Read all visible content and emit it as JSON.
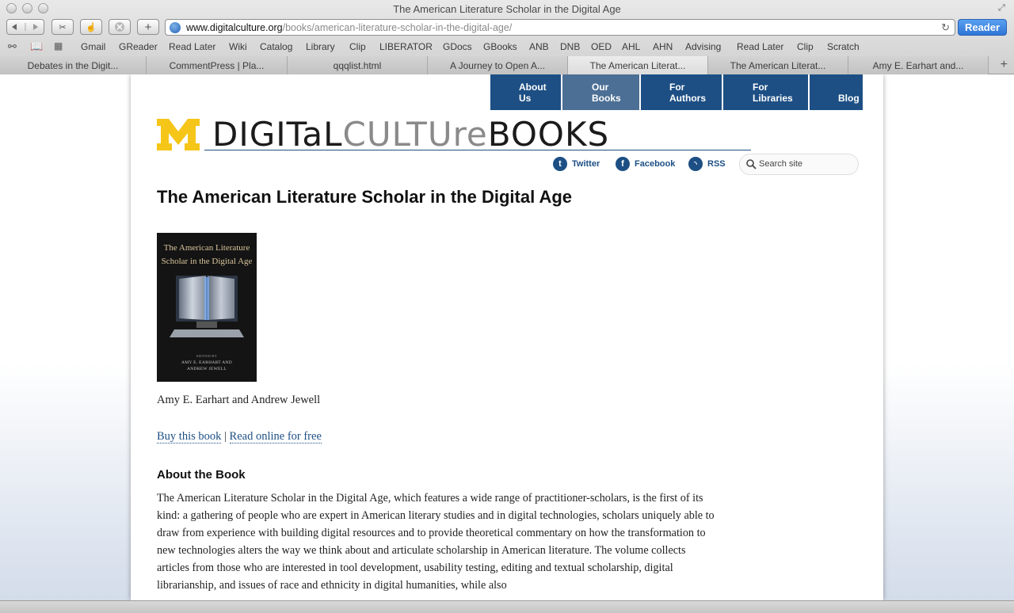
{
  "window": {
    "title": "The American Literature Scholar in the Digital Age"
  },
  "toolbar": {
    "url_host": "www.digitalculture.org",
    "url_path": "/books/american-literature-scholar-in-the-digital-age/",
    "reader_label": "Reader"
  },
  "bookmarks": [
    "Gmail",
    "GReader",
    "Read Later",
    "Wiki",
    "Catalog",
    "Library",
    "Clip",
    "LIBERATOR",
    "GDocs",
    "GBooks",
    "ANB",
    "DNB",
    "OED",
    "AHL",
    "AHN",
    "Advising",
    "Read Later",
    "Clip",
    "Scratch"
  ],
  "tabs": [
    "Debates in the Digit...",
    "CommentPress | Pla...",
    "qqqlist.html",
    "A Journey to Open A...",
    "The American Literat...",
    "The American Literat...",
    "Amy E. Earhart and..."
  ],
  "site": {
    "nav": [
      "About Us",
      "Our Books",
      "For Authors",
      "For Libraries",
      "Blog"
    ],
    "logo_m": "M",
    "logo_digital": "DIGITaL",
    "logo_culture": "CULTUre",
    "logo_books": "BOOKS",
    "social": {
      "twitter": "Twitter",
      "facebook": "Facebook",
      "rss": "RSS"
    },
    "search_placeholder": "Search site",
    "colors": {
      "nav_blue": "#1d4f84",
      "maize": "#f5c518"
    }
  },
  "book": {
    "title": "The American Literature Scholar in the Digital Age",
    "cover_title_line1": "The American Literature",
    "cover_title_line2": "Scholar in the Digital Age",
    "cover_edited_by": "EDITED BY",
    "cover_editor1": "AMY E. EARHART AND",
    "cover_editor2": "ANDREW JEWELL",
    "authors": "Amy E. Earhart and Andrew Jewell",
    "buy_label": "Buy this book",
    "separator": "|",
    "read_label": "Read online for free",
    "about_heading": "About the Book",
    "about_text": "The American Literature Scholar in the Digital Age, which features a wide range of practitioner-scholars, is the first of its kind: a gathering of people who are expert in American literary studies and in digital technologies, scholars uniquely able to draw from experience with building digital resources and to provide theoretical commentary on how the transformation to new technologies alters the way we think about and articulate scholarship in American literature. The volume collects articles from those who are interested in tool development, usability testing, editing and textual scholarship, digital librarianship, and issues of race and ethnicity in digital humanities, while also"
  }
}
